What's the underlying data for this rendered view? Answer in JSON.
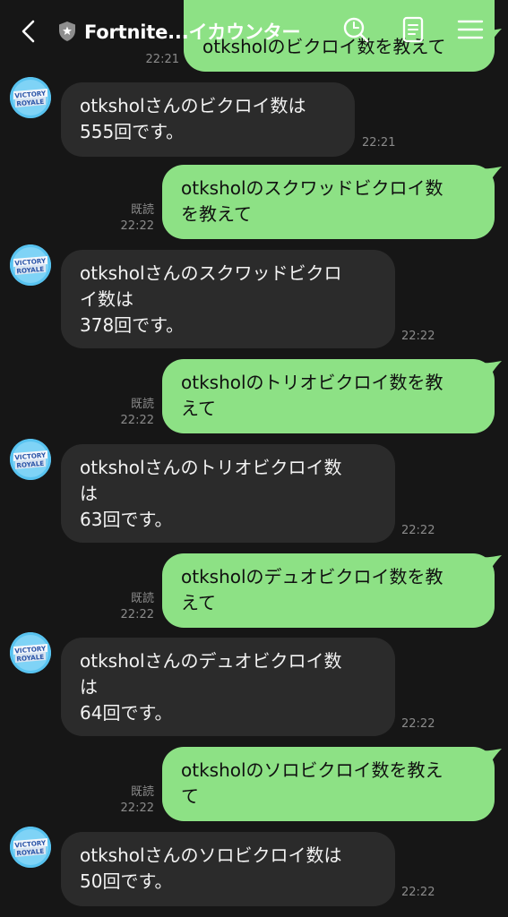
{
  "header": {
    "title": "Fortnite...イカウンター",
    "back_icon": "chevron-left-icon",
    "shield_icon": "shield-star-icon",
    "search_icon": "search-icon",
    "notes_icon": "notes-icon",
    "menu_icon": "menu-icon"
  },
  "avatar": {
    "text_top": "VICTORY",
    "text_bottom": "ROYALE"
  },
  "messages": [
    {
      "dir": "out",
      "text": "otksholのビクロイ数を教えて",
      "time": "22:21"
    },
    {
      "dir": "in",
      "text": "otksholさんのビクロイ数は\n555回です。",
      "time": "22:21"
    },
    {
      "dir": "out",
      "text": "otksholのスクワッドビクロイ数\nを教えて",
      "time": "22:22",
      "read": "既読"
    },
    {
      "dir": "in",
      "text": "otksholさんのスクワッドビクロ\nイ数は\n378回です。",
      "time": "22:22"
    },
    {
      "dir": "out",
      "text": "otksholのトリオビクロイ数を教\nえて",
      "time": "22:22",
      "read": "既読"
    },
    {
      "dir": "in",
      "text": "otksholさんのトリオビクロイ数\nは\n63回です。",
      "time": "22:22"
    },
    {
      "dir": "out",
      "text": "otksholのデュオビクロイ数を教\nえて",
      "time": "22:22",
      "read": "既読"
    },
    {
      "dir": "in",
      "text": "otksholさんのデュオビクロイ数\nは\n64回です。",
      "time": "22:22"
    },
    {
      "dir": "out",
      "text": "otksholのソロビクロイ数を教え\nて",
      "time": "22:22",
      "read": "既読"
    },
    {
      "dir": "in",
      "text": "otksholさんのソロビクロイ数は\n50回です。",
      "time": "22:22"
    }
  ],
  "colors": {
    "background": "#161616",
    "incoming_bubble": "#2b2b2b",
    "outgoing_bubble": "#8de185",
    "meta_text": "#8a8a8a",
    "avatar_bg": "#5cc6f2"
  }
}
